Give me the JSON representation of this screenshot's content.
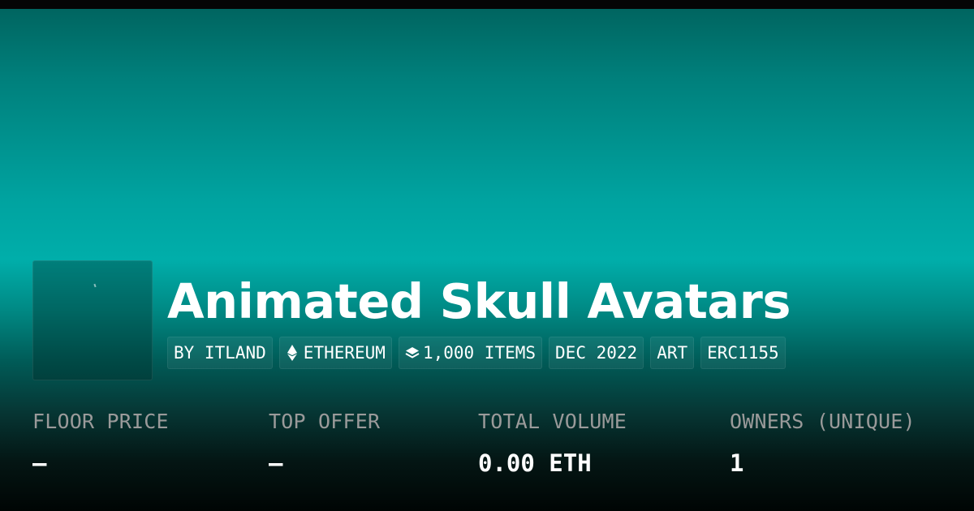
{
  "collection": {
    "name": "Animated Skull Avatars",
    "tags": [
      {
        "label": "BY ITLAND",
        "icon": ""
      },
      {
        "label": "ETHEREUM",
        "icon": "ethereum-icon"
      },
      {
        "label": "1,000 ITEMS",
        "icon": "layers-icon"
      },
      {
        "label": "DEC 2022",
        "icon": ""
      },
      {
        "label": "ART",
        "icon": ""
      },
      {
        "label": "ERC1155",
        "icon": ""
      }
    ]
  },
  "stats": [
    {
      "label": "FLOOR PRICE",
      "value": "–"
    },
    {
      "label": "TOP OFFER",
      "value": "–"
    },
    {
      "label": "TOTAL VOLUME",
      "value": "0.00 ETH"
    },
    {
      "label": "OWNERS (UNIQUE)",
      "value": "1"
    }
  ],
  "colors": {
    "banner_accent": "#00aeaa",
    "text": "#ffffff",
    "muted_label": "#9a9a9a"
  }
}
